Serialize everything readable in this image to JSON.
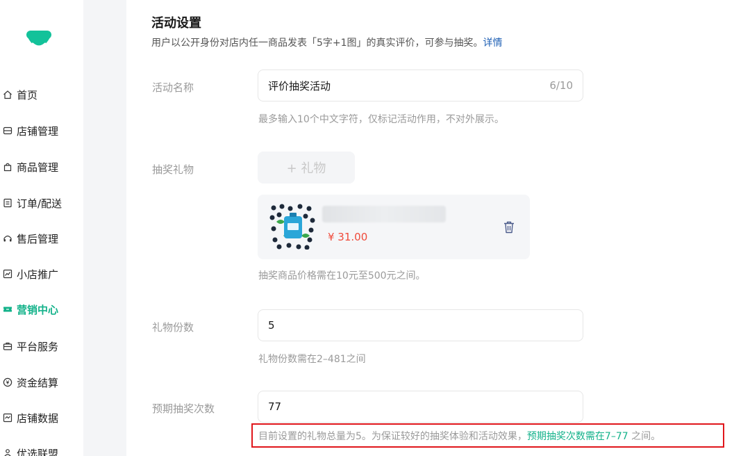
{
  "sidebar": {
    "items": [
      {
        "label": "首页",
        "icon": "home-icon"
      },
      {
        "label": "店铺管理",
        "icon": "store-icon"
      },
      {
        "label": "商品管理",
        "icon": "bag-icon"
      },
      {
        "label": "订单/配送",
        "icon": "order-icon"
      },
      {
        "label": "售后管理",
        "icon": "headset-icon"
      },
      {
        "label": "小店推广",
        "icon": "chart-icon"
      },
      {
        "label": "营销中心",
        "icon": "ticket-icon",
        "active": true
      },
      {
        "label": "平台服务",
        "icon": "briefcase-icon"
      },
      {
        "label": "资金结算",
        "icon": "yen-icon"
      },
      {
        "label": "店铺数据",
        "icon": "data-icon"
      },
      {
        "label": "优选联盟",
        "icon": "people-icon"
      }
    ]
  },
  "main": {
    "title": "活动设置",
    "desc": "用户以公开身份对店内任一商品发表「5字+1图」的真实评价，可参与抽奖。",
    "desc_link": "详情",
    "fields": {
      "activity_name": {
        "label": "活动名称",
        "value": "评价抽奖活动",
        "count": "6/10",
        "hint": "最多输入10个中文字符，仅标记活动作用，不对外展示。"
      },
      "gift": {
        "label": "抽奖礼物",
        "add_label": "+ 礼物",
        "price": "¥ 31.00",
        "hint": "抽奖商品价格需在10元至500元之间。"
      },
      "gift_count": {
        "label": "礼物份数",
        "value": "5",
        "hint": "礼物份数需在2–481之间"
      },
      "draw_count": {
        "label": "预期抽奖次数",
        "value": "77",
        "warn_prefix": "目前设置的礼物总量为5。为保证较好的抽奖体验和活动效果，",
        "warn_highlight": "预期抽奖次数需在7–77",
        "warn_suffix": " 之间。"
      }
    }
  },
  "colors": {
    "accent": "#13b28a",
    "price": "#f04a3a",
    "link": "#1e5fb4",
    "highlight_box": "#e0161b"
  }
}
